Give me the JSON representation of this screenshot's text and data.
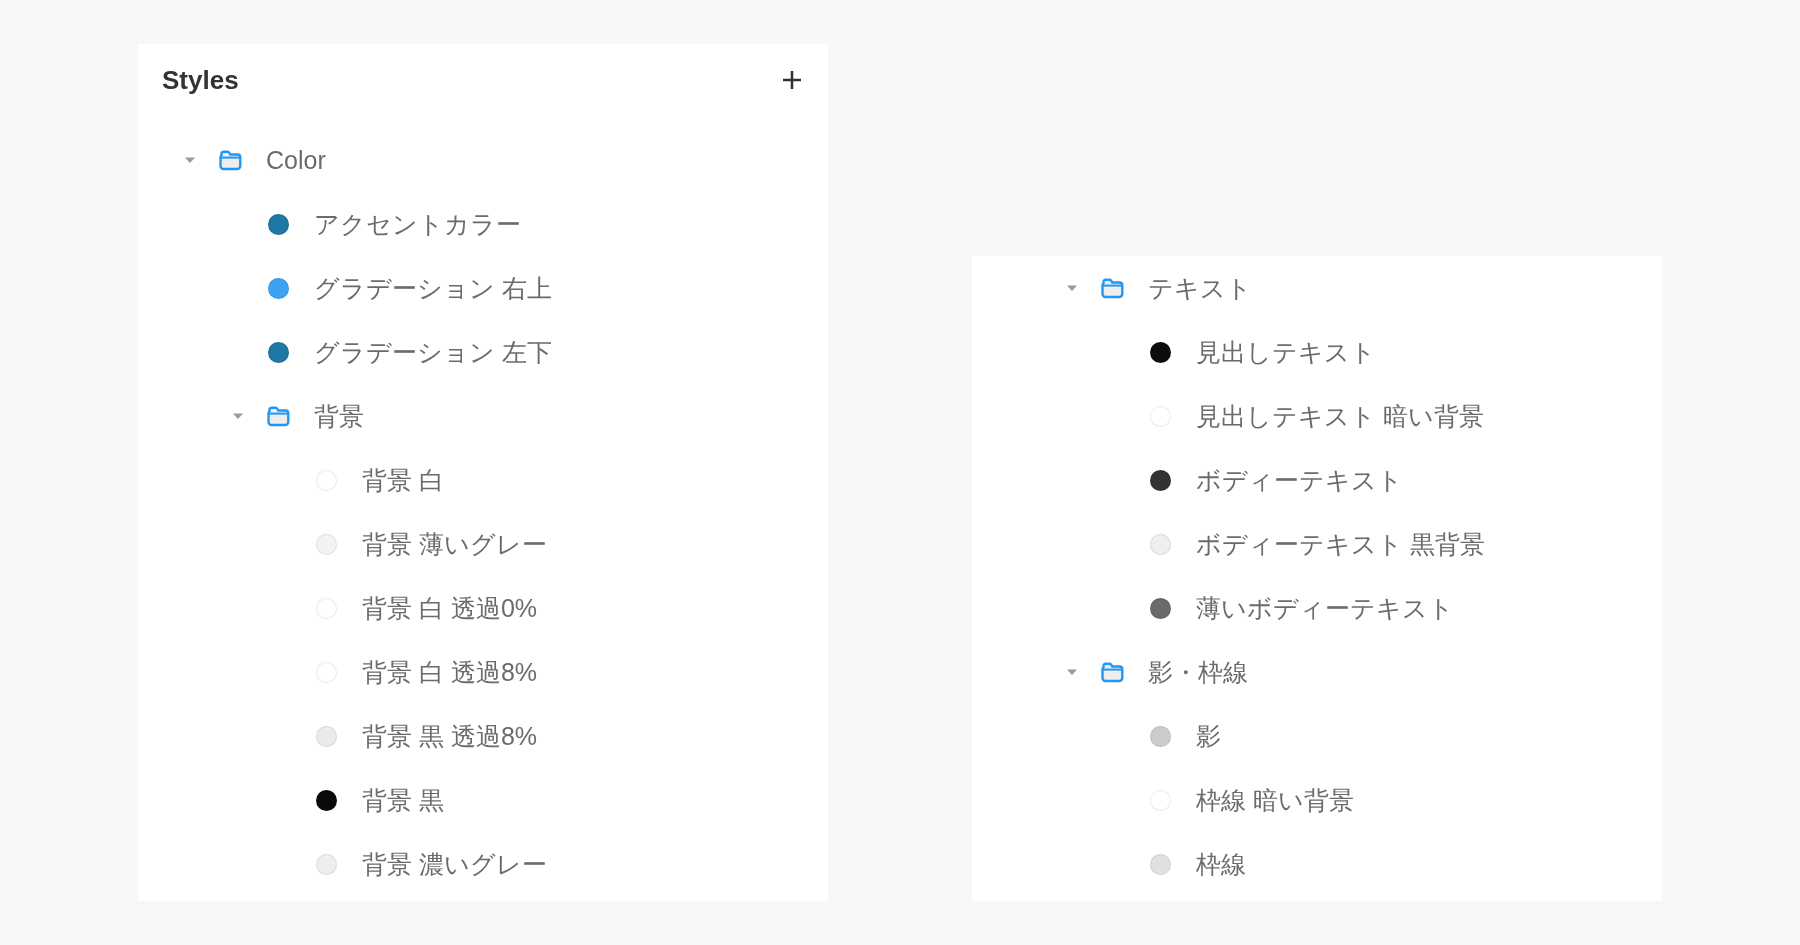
{
  "panels": [
    {
      "title": "Styles",
      "items": [
        {
          "kind": "folder",
          "label": "Color",
          "expanded": true,
          "children": [
            {
              "kind": "style",
              "label": "アクセントカラー",
              "color": "#1f77a3"
            },
            {
              "kind": "style",
              "label": "グラデーション 右上",
              "color": "#3fa2f0"
            },
            {
              "kind": "style",
              "label": "グラデーション 左下",
              "color": "#1f77a3"
            },
            {
              "kind": "folder",
              "label": "背景",
              "expanded": true,
              "children": [
                {
                  "kind": "style",
                  "label": "背景 白",
                  "color": "#ffffff"
                },
                {
                  "kind": "style",
                  "label": "背景 薄いグレー",
                  "color": "#f3f3f3"
                },
                {
                  "kind": "style",
                  "label": "背景 白 透過0%",
                  "color": "#ffffff"
                },
                {
                  "kind": "style",
                  "label": "背景 白 透過8%",
                  "color": "#ffffff"
                },
                {
                  "kind": "style",
                  "label": "背景 黒 透過8%",
                  "color": "#ebebeb"
                },
                {
                  "kind": "style",
                  "label": "背景 黒",
                  "color": "#0a0a0a"
                },
                {
                  "kind": "style",
                  "label": "背景 濃いグレー",
                  "color": "#eeeeee"
                }
              ]
            }
          ]
        }
      ]
    },
    {
      "items": [
        {
          "kind": "folder",
          "label": "テキスト",
          "expanded": true,
          "children": [
            {
              "kind": "style",
              "label": "見出しテキスト",
              "color": "#0d0d0d"
            },
            {
              "kind": "style",
              "label": "見出しテキスト 暗い背景",
              "color": "#ffffff"
            },
            {
              "kind": "style",
              "label": "ボディーテキスト",
              "color": "#333333"
            },
            {
              "kind": "style",
              "label": "ボディーテキスト 黒背景",
              "color": "#eeeeee"
            },
            {
              "kind": "style",
              "label": "薄いボディーテキスト",
              "color": "#6b6b6b"
            }
          ]
        },
        {
          "kind": "folder",
          "label": "影・枠線",
          "expanded": true,
          "children": [
            {
              "kind": "style",
              "label": "影",
              "color": "#cccccc"
            },
            {
              "kind": "style",
              "label": "枠線 暗い背景",
              "color": "#ffffff"
            },
            {
              "kind": "style",
              "label": "枠線",
              "color": "#dfe1e3"
            }
          ]
        }
      ]
    }
  ]
}
